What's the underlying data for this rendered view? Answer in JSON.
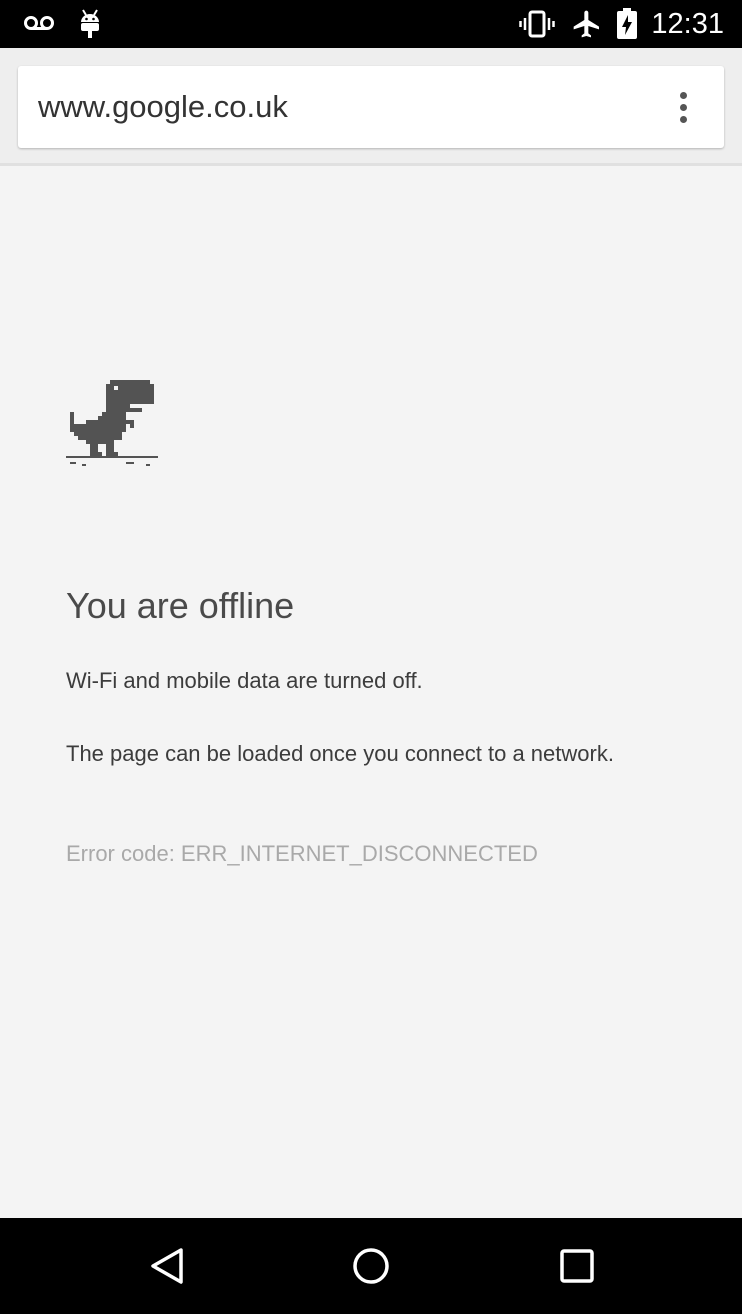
{
  "status_bar": {
    "time": "12:31",
    "icons": [
      "voicemail-icon",
      "android-debug-icon",
      "vibrate-icon",
      "airplane-mode-icon",
      "battery-charging-icon"
    ]
  },
  "toolbar": {
    "url": "www.google.co.uk",
    "menu_icon": "more-vert-icon"
  },
  "error_page": {
    "illustration": "dino-icon",
    "title": "You are offline",
    "line1": "Wi-Fi and mobile data are turned off.",
    "line2": "The page can be loaded once you connect to a network.",
    "error_code": "Error code: ERR_INTERNET_DISCONNECTED"
  },
  "nav_bar": {
    "buttons": [
      "back-icon",
      "home-icon",
      "recents-icon"
    ]
  },
  "colors": {
    "page_background": "#f4f4f4",
    "status_bar": "#000000",
    "headline": "#4a4a4a",
    "body_text": "#3c3c3c",
    "error_code": "#a9a9a9"
  }
}
